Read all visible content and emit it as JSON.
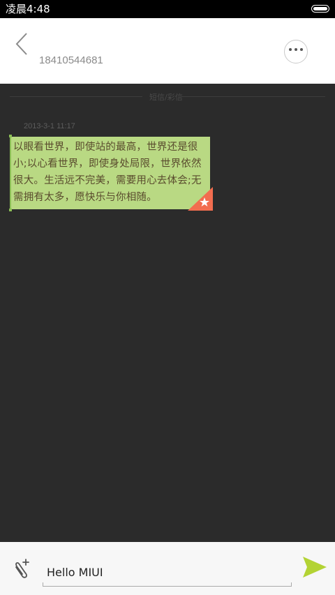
{
  "status_bar": {
    "time": "凌晨4:48",
    "battery_icon": "battery-icon"
  },
  "header": {
    "back_icon": "chevron-left-icon",
    "contact_number": "18410544681",
    "more_icon": "more-options-icon"
  },
  "conversation": {
    "divider_label": "短信/彩信",
    "messages": [
      {
        "time": "2013-3-1 11:17",
        "text": "以眼看世界，即使站的最高，世界还是很小;以心看世界，即使身处局限，世界依然很大。生活远不完美，需要用心去体会;无需拥有太多，愿快乐与你相随。",
        "starred": true,
        "selected": true
      }
    ]
  },
  "composer": {
    "attach_icon": "paperclip-add-icon",
    "input_value": "Hello MIUI",
    "send_icon": "send-icon"
  },
  "colors": {
    "bubble": "#b9d983",
    "star_corner": "#f26d4f",
    "send_accent": "#b3d334",
    "background": "#2b2b2b"
  }
}
